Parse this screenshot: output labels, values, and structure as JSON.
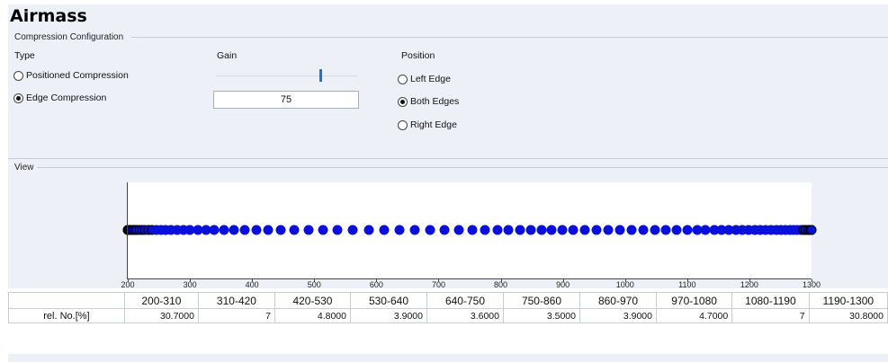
{
  "title": "Airmass",
  "compression": {
    "group_label": "Compression Configuration",
    "type_header": "Type",
    "gain_header": "Gain",
    "position_header": "Position",
    "type_options": [
      {
        "label": "Positioned Compression",
        "selected": false
      },
      {
        "label": "Edge Compression",
        "selected": true
      }
    ],
    "gain_value": "75",
    "position_options": [
      {
        "label": "Left Edge",
        "selected": false
      },
      {
        "label": "Both Edges",
        "selected": true
      },
      {
        "label": "Right Edge",
        "selected": false
      }
    ]
  },
  "view": {
    "group_label": "View"
  },
  "chart_data": {
    "type": "scatter",
    "xlim": [
      200,
      1300
    ],
    "xticks": [
      "200",
      "300",
      "400",
      "500",
      "600",
      "700",
      "800",
      "900",
      "1000",
      "1100",
      "1200",
      "1300"
    ],
    "marker_color": "#0a10dc",
    "marker_edge_color_dense": "#000000",
    "x": [
      200.0,
      200.4,
      201.2,
      202.4,
      204.0,
      206.0,
      208.4,
      211.3,
      214.6,
      218.5,
      222.8,
      227.6,
      233.0,
      239.0,
      245.6,
      252.9,
      260.8,
      269.5,
      279.0,
      289.3,
      300.4,
      312.4,
      325.4,
      339.4,
      354.5,
      370.6,
      387.9,
      406.4,
      425.9,
      446.5,
      468.1,
      490.6,
      513.9,
      537.9,
      562.4,
      587.3,
      612.5,
      637.6,
      662.4,
      686.6,
      710.0,
      732.5,
      754.1,
      774.6,
      794.2,
      812.9,
      830.9,
      848.3,
      865.3,
      882.3,
      899.5,
      917.1,
      935.1,
      953.5,
      972.3,
      991.3,
      1010.4,
      1029.4,
      1048.1,
      1066.2,
      1083.6,
      1100.1,
      1115.5,
      1129.9,
      1143.3,
      1155.8,
      1167.5,
      1178.5,
      1189.0,
      1199.0,
      1208.7,
      1218.0,
      1226.9,
      1235.4,
      1243.5,
      1251.2,
      1258.4,
      1265.1,
      1271.3,
      1277.0,
      1282.1,
      1286.6,
      1290.5,
      1293.8,
      1296.4,
      1298.3,
      1299.5,
      1300.0
    ]
  },
  "table": {
    "headers": [
      "",
      "200-310",
      "310-420",
      "420-530",
      "530-640",
      "640-750",
      "750-860",
      "860-970",
      "970-1080",
      "1080-1190",
      "1190-1300"
    ],
    "row_label": "rel. No.[%]",
    "values": [
      "30.7000",
      "7",
      "4.8000",
      "3.9000",
      "3.6000",
      "3.5000",
      "3.9000",
      "4.7000",
      "7",
      "30.8000"
    ]
  }
}
